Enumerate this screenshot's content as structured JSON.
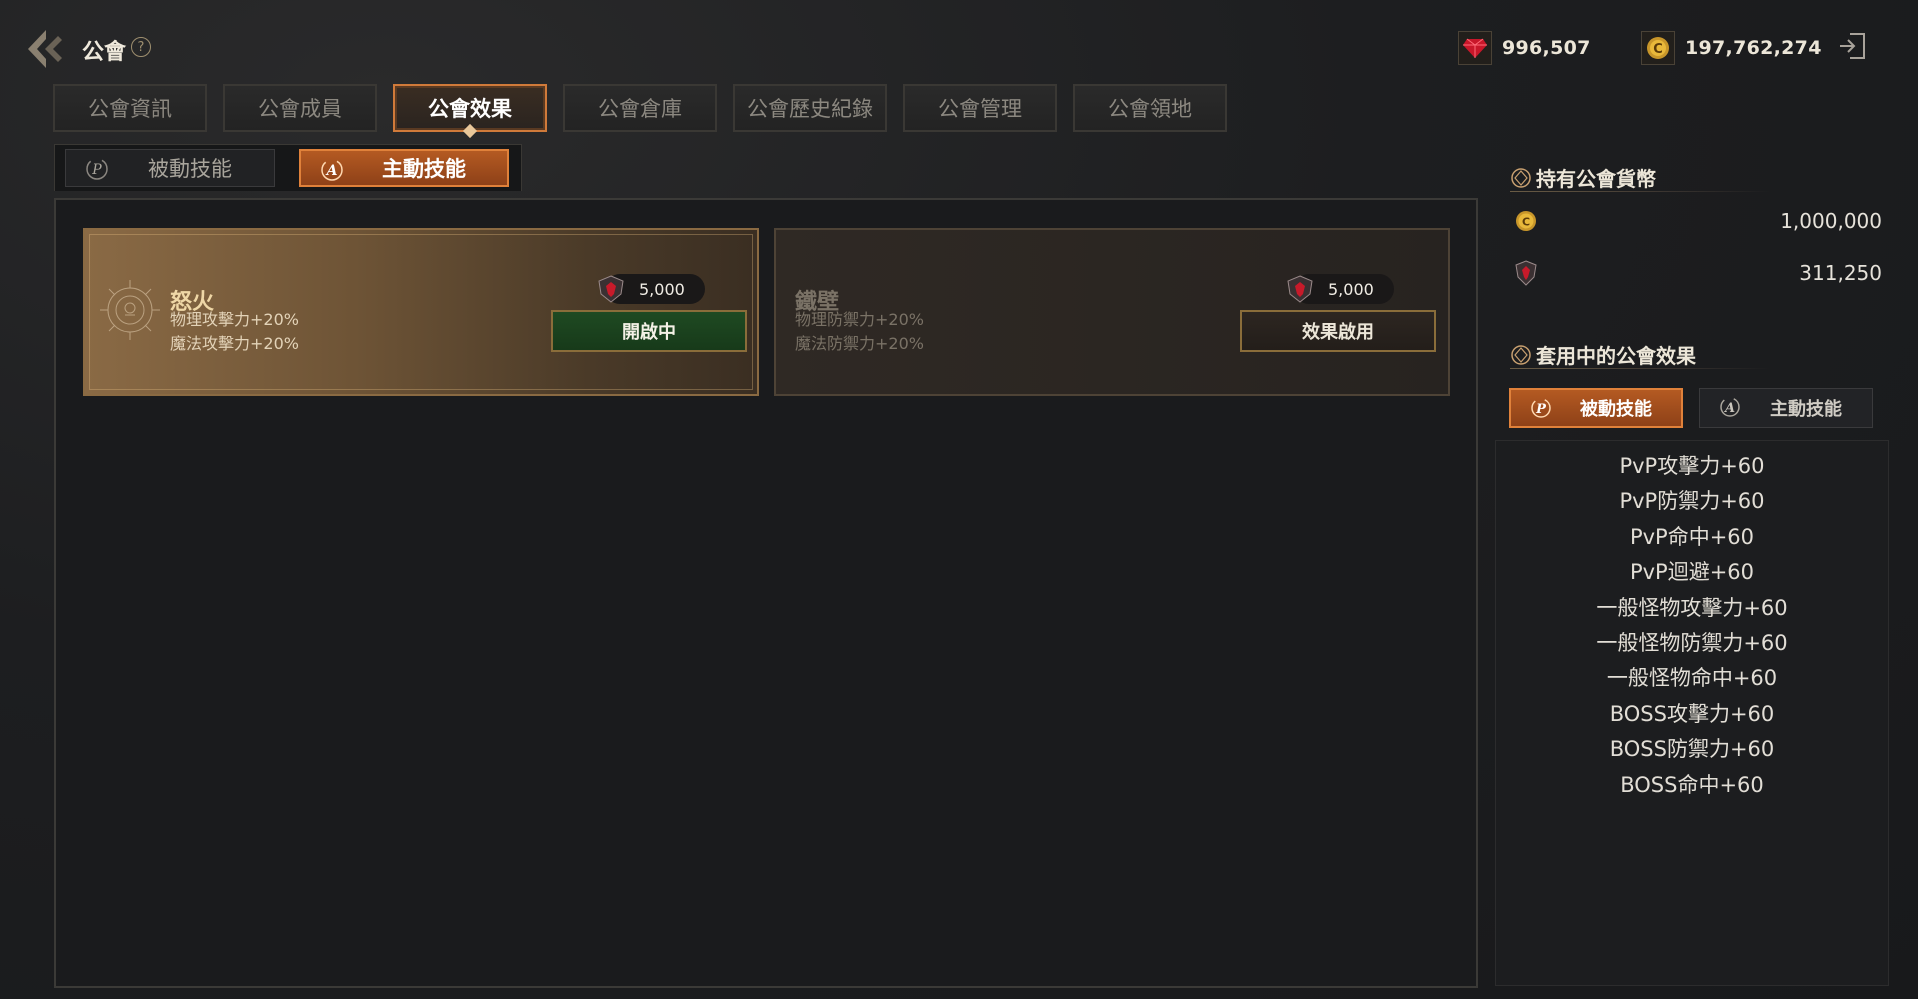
{
  "header": {
    "title": "公會",
    "help_glyph": "?",
    "currency_gem": "996,507",
    "currency_coin": "197,762,274"
  },
  "tabs": [
    {
      "label": "公會資訊"
    },
    {
      "label": "公會成員"
    },
    {
      "label": "公會效果"
    },
    {
      "label": "公會倉庫"
    },
    {
      "label": "公會歷史紀錄"
    },
    {
      "label": "公會管理"
    },
    {
      "label": "公會領地"
    }
  ],
  "active_tab": "公會效果",
  "subtabs": {
    "passive": "被動技能",
    "active": "主動技能"
  },
  "skills": [
    {
      "name": "怒火",
      "effect1": "物理攻擊力+20%",
      "effect2": "魔法攻擊力+20%",
      "cost": "5,000",
      "button": "開啟中",
      "state": "on"
    },
    {
      "name": "鐵壁",
      "effect1": "物理防禦力+20%",
      "effect2": "魔法防禦力+20%",
      "cost": "5,000",
      "button": "效果啟用",
      "state": "off"
    }
  ],
  "guild_currency": {
    "title": "持有公會貨幣",
    "coin": "1,000,000",
    "gem": "311,250"
  },
  "applied_effects": {
    "title": "套用中的公會效果",
    "tab_passive": "被動技能",
    "tab_active": "主動技能",
    "items": [
      "PvP攻擊力+60",
      "PvP防禦力+60",
      "PvP命中+60",
      "PvP迴避+60",
      "一般怪物攻擊力+60",
      "一般怪物防禦力+60",
      "一般怪物命中+60",
      "BOSS攻擊力+60",
      "BOSS防禦力+60",
      "BOSS命中+60"
    ]
  },
  "colors": {
    "accent_orange": "#e0813a",
    "active_green": "#1f4a22",
    "gold_border": "#8a6a42"
  }
}
